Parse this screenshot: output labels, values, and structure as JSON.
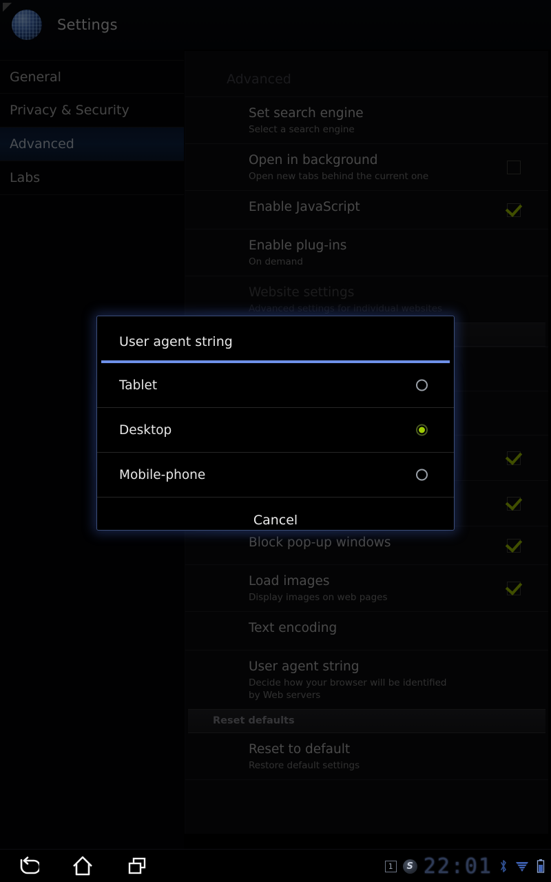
{
  "app": {
    "title": "Settings",
    "icon": "browser-globe-icon"
  },
  "sidebar": {
    "items": [
      {
        "label": "General",
        "selected": false
      },
      {
        "label": "Privacy & Security",
        "selected": false
      },
      {
        "label": "Advanced",
        "selected": true
      },
      {
        "label": "Labs",
        "selected": false
      }
    ]
  },
  "main": {
    "heading": "Advanced",
    "rows": [
      {
        "title": "Set search engine",
        "sub": "Select a search engine",
        "control": "none"
      },
      {
        "title": "Open in background",
        "sub": "Open new tabs behind the current one",
        "control": "checkbox",
        "checked": false
      },
      {
        "title": "Enable JavaScript",
        "sub": "",
        "control": "checkbox",
        "checked": true
      },
      {
        "title": "Enable plug-ins",
        "sub": "On demand",
        "control": "none"
      },
      {
        "title": "Website settings",
        "sub": "Advanced settings for individual websites",
        "control": "none"
      },
      {
        "title": "Block pop-up windows",
        "sub": "",
        "control": "checkbox",
        "checked": true
      },
      {
        "title": "Load images",
        "sub": "Display images on web pages",
        "control": "checkbox",
        "checked": true
      },
      {
        "title": "Text encoding",
        "sub": "",
        "control": "none"
      },
      {
        "title": "User agent string",
        "sub": "Decide how your browser will be identified by Web servers",
        "control": "none"
      }
    ],
    "section_header": "Reset defaults",
    "reset_row": {
      "title": "Reset to default",
      "sub": "Restore default settings"
    }
  },
  "dialog": {
    "title": "User agent string",
    "options": [
      {
        "label": "Tablet",
        "selected": false
      },
      {
        "label": "Desktop",
        "selected": true
      },
      {
        "label": "Mobile-phone",
        "selected": false
      }
    ],
    "cancel_label": "Cancel",
    "accent_color": "#6e90e8",
    "selected_radio_color": "#9ecb04"
  },
  "systembar": {
    "back_icon": "back-arrow-icon",
    "home_icon": "home-icon",
    "recents_icon": "recent-apps-icon",
    "notification_count": "1",
    "skype_glyph": "S",
    "clock": "22:01",
    "bluetooth_icon": "bluetooth-icon",
    "wifi_icon": "wifi-icon",
    "battery_icon": "battery-icon"
  }
}
